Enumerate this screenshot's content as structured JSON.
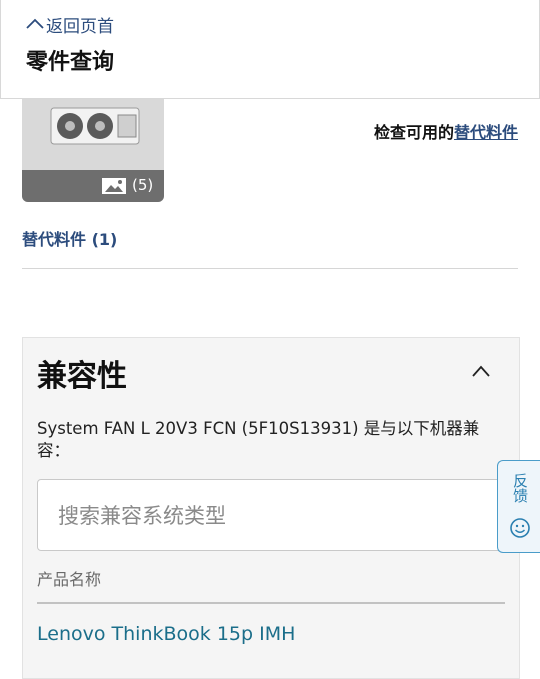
{
  "header": {
    "back_label": "返回页首",
    "title": "零件查询"
  },
  "part": {
    "image_count": "(5)",
    "check_prefix": "检查可用的",
    "check_link": "替代料件",
    "alt_parts_label": "替代料件 (1)"
  },
  "compat": {
    "title": "兼容性",
    "description": "System FAN L 20V3 FCN (5F10S13931) 是与以下机器兼容：",
    "search_placeholder": "搜索兼容系统类型",
    "search_value": "",
    "column_header": "产品名称",
    "products": [
      "Lenovo ThinkBook 15p IMH"
    ]
  },
  "feedback": {
    "label": "反馈"
  },
  "colors": {
    "accent": "#2c4c7d",
    "link_teal": "#1b6e8a",
    "feedback_blue": "#2a7fb0"
  }
}
